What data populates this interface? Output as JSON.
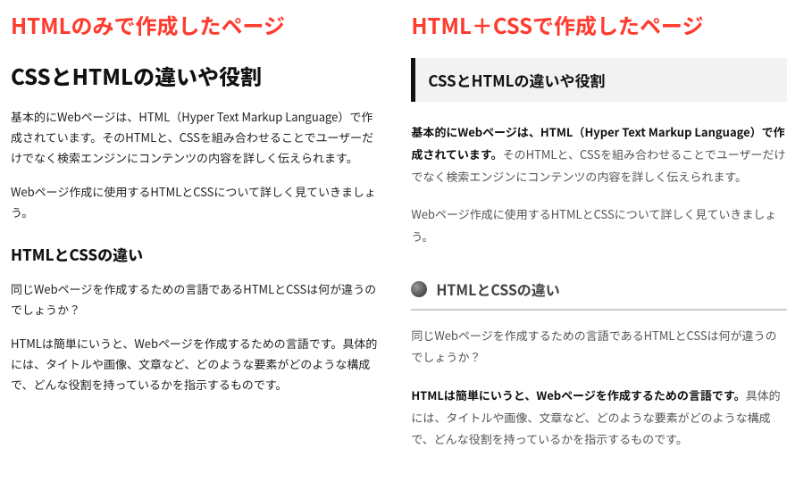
{
  "left": {
    "top_title": "HTMLのみで作成したページ",
    "h1": "CSSとHTMLの違いや役割",
    "p1": "基本的にWebページは、HTML（Hyper Text Markup Language）で作成されています。そのHTMLと、CSSを組み合わせることでユーザーだけでなく検索エンジンにコンテンツの内容を詳しく伝えられます。",
    "p2": "Webページ作成に使用するHTMLとCSSについて詳しく見ていきましょう。",
    "h2": "HTMLとCSSの違い",
    "p3": "同じWebページを作成するための言語であるHTMLとCSSは何が違うのでしょうか？",
    "p4": "HTMLは簡単にいうと、Webページを作成するための言語です。具体的には、タイトルや画像、文章など、どのような要素がどのような構成で、どんな役割を持っているかを指示するものです。"
  },
  "right": {
    "top_title": "HTML＋CSSで作成したページ",
    "h1": "CSSとHTMLの違いや役割",
    "p1_bold": "基本的にWebページは、HTML（Hyper Text Markup Language）で作成されています。",
    "p1_rest": "そのHTMLと、CSSを組み合わせることでユーザーだけでなく検索エンジンにコンテンツの内容を詳しく伝えられます。",
    "p2": "Webページ作成に使用するHTMLとCSSについて詳しく見ていきましょう。",
    "h2": "HTMLとCSSの違い",
    "p3": "同じWebページを作成するための言語であるHTMLとCSSは何が違うのでしょうか？",
    "p4_bold": "HTMLは簡単にいうと、Webページを作成するための言語です。",
    "p4_rest": "具体的には、タイトルや画像、文章など、どのような要素がどのような構成で、どんな役割を持っているかを指示するものです。"
  }
}
